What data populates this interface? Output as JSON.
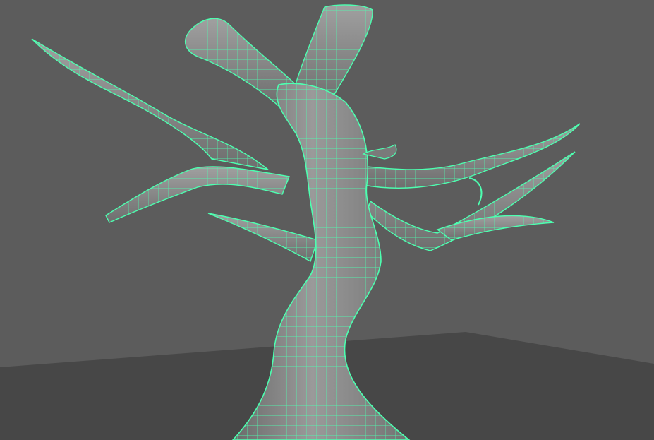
{
  "viewport": {
    "background_color": "#5a5a5a",
    "floor_color": "#474747",
    "mesh_fill_color": "#8a8a8a",
    "mesh_shadow_color": "#4a4a4a",
    "wireframe_color": "#4dffb0",
    "wireframe_highlight_color": "#2fd89a"
  },
  "scene": {
    "object": "tree-mesh",
    "selection_state": "selected",
    "display_mode": "wireframe-on-shaded"
  }
}
